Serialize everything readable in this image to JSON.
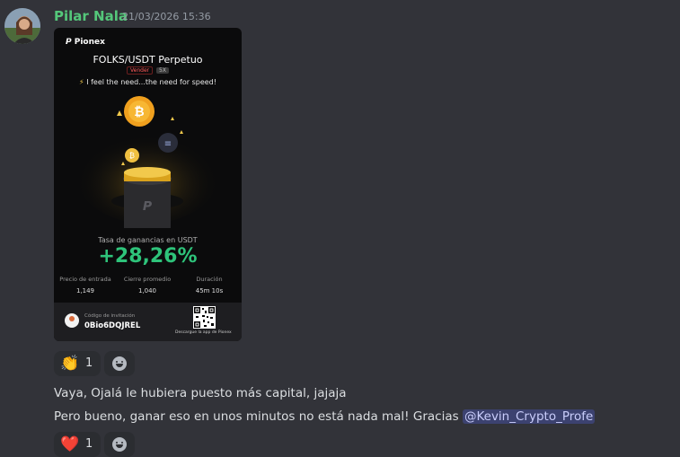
{
  "message": {
    "author": "Pilar Nala",
    "timestamp": "21/03/2026 15:36",
    "lines": [
      "Vaya, Ojalá le hubiera puesto más capital, jajaja",
      "Pero bueno, ganar eso en unos minutos no está nada mal! Gracias"
    ],
    "mention": "@Kevin_Crypto_Profe"
  },
  "card": {
    "brand": "Pionex",
    "pair": "FOLKS/USDT Perpetuo",
    "side_badge": "Vender",
    "leverage_badge": "5X",
    "tagline": "I feel the need...the need for speed!",
    "return_label": "Tasa de ganancias en USDT",
    "return_value": "+28,26%",
    "stats": [
      {
        "label": "Precio de entrada",
        "value": "1,149"
      },
      {
        "label": "Cierre promedio",
        "value": "1,040"
      },
      {
        "label": "Duración",
        "value": "45m 10s"
      }
    ],
    "invite_label": "Código de invitación",
    "invite_code": "0Bio6DQJREL",
    "download_label": "Descargue la app de Pionex"
  },
  "reactions": [
    {
      "icon": "clapping-hands-icon",
      "emoji": "👏",
      "count": "1"
    },
    {
      "icon": "heart-icon",
      "emoji": "❤️",
      "count": "1"
    }
  ],
  "colors": {
    "background": "#323339",
    "author": "#54c77a",
    "gain": "#2ec37a",
    "mention_bg": "#3c4270"
  }
}
